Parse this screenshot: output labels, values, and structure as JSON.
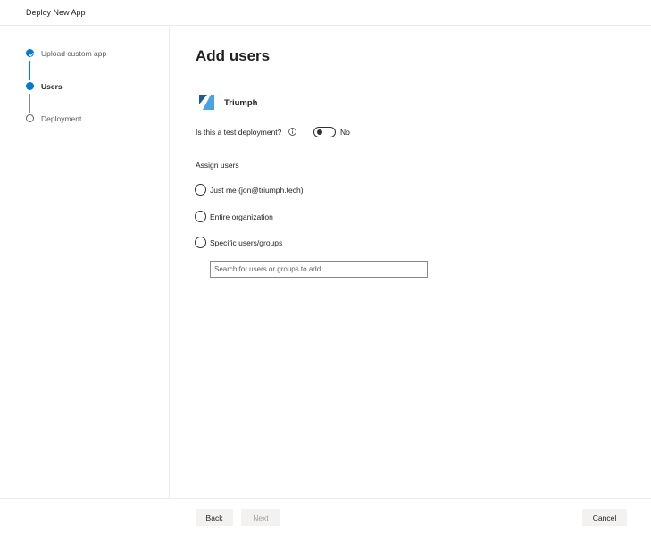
{
  "window": {
    "title": "Deploy New App"
  },
  "steps": [
    {
      "label": "Upload custom app",
      "state": "completed"
    },
    {
      "label": "Users",
      "state": "current"
    },
    {
      "label": "Deployment",
      "state": "pending"
    }
  ],
  "main": {
    "title": "Add users",
    "app": {
      "name": "Triumph",
      "logo_icon": "triumph-logo-icon"
    },
    "test_deployment": {
      "label": "Is this a test deployment?",
      "info_icon": "info-icon",
      "toggle_on": false,
      "toggle_text": "No"
    },
    "assign_users": {
      "label": "Assign users",
      "options": [
        {
          "label": "Just me (jon@triumph.tech)",
          "selected": false
        },
        {
          "label": "Entire organization",
          "selected": false
        },
        {
          "label": "Specific users/groups",
          "selected": false
        }
      ],
      "search": {
        "placeholder": "Search for users or groups to add",
        "value": ""
      }
    }
  },
  "footer": {
    "back_label": "Back",
    "next_label": "Next",
    "cancel_label": "Cancel",
    "next_enabled": false
  },
  "colors": {
    "accent": "#0078d4",
    "logo_dark": "#1f5c99",
    "logo_light": "#4aa3df"
  }
}
